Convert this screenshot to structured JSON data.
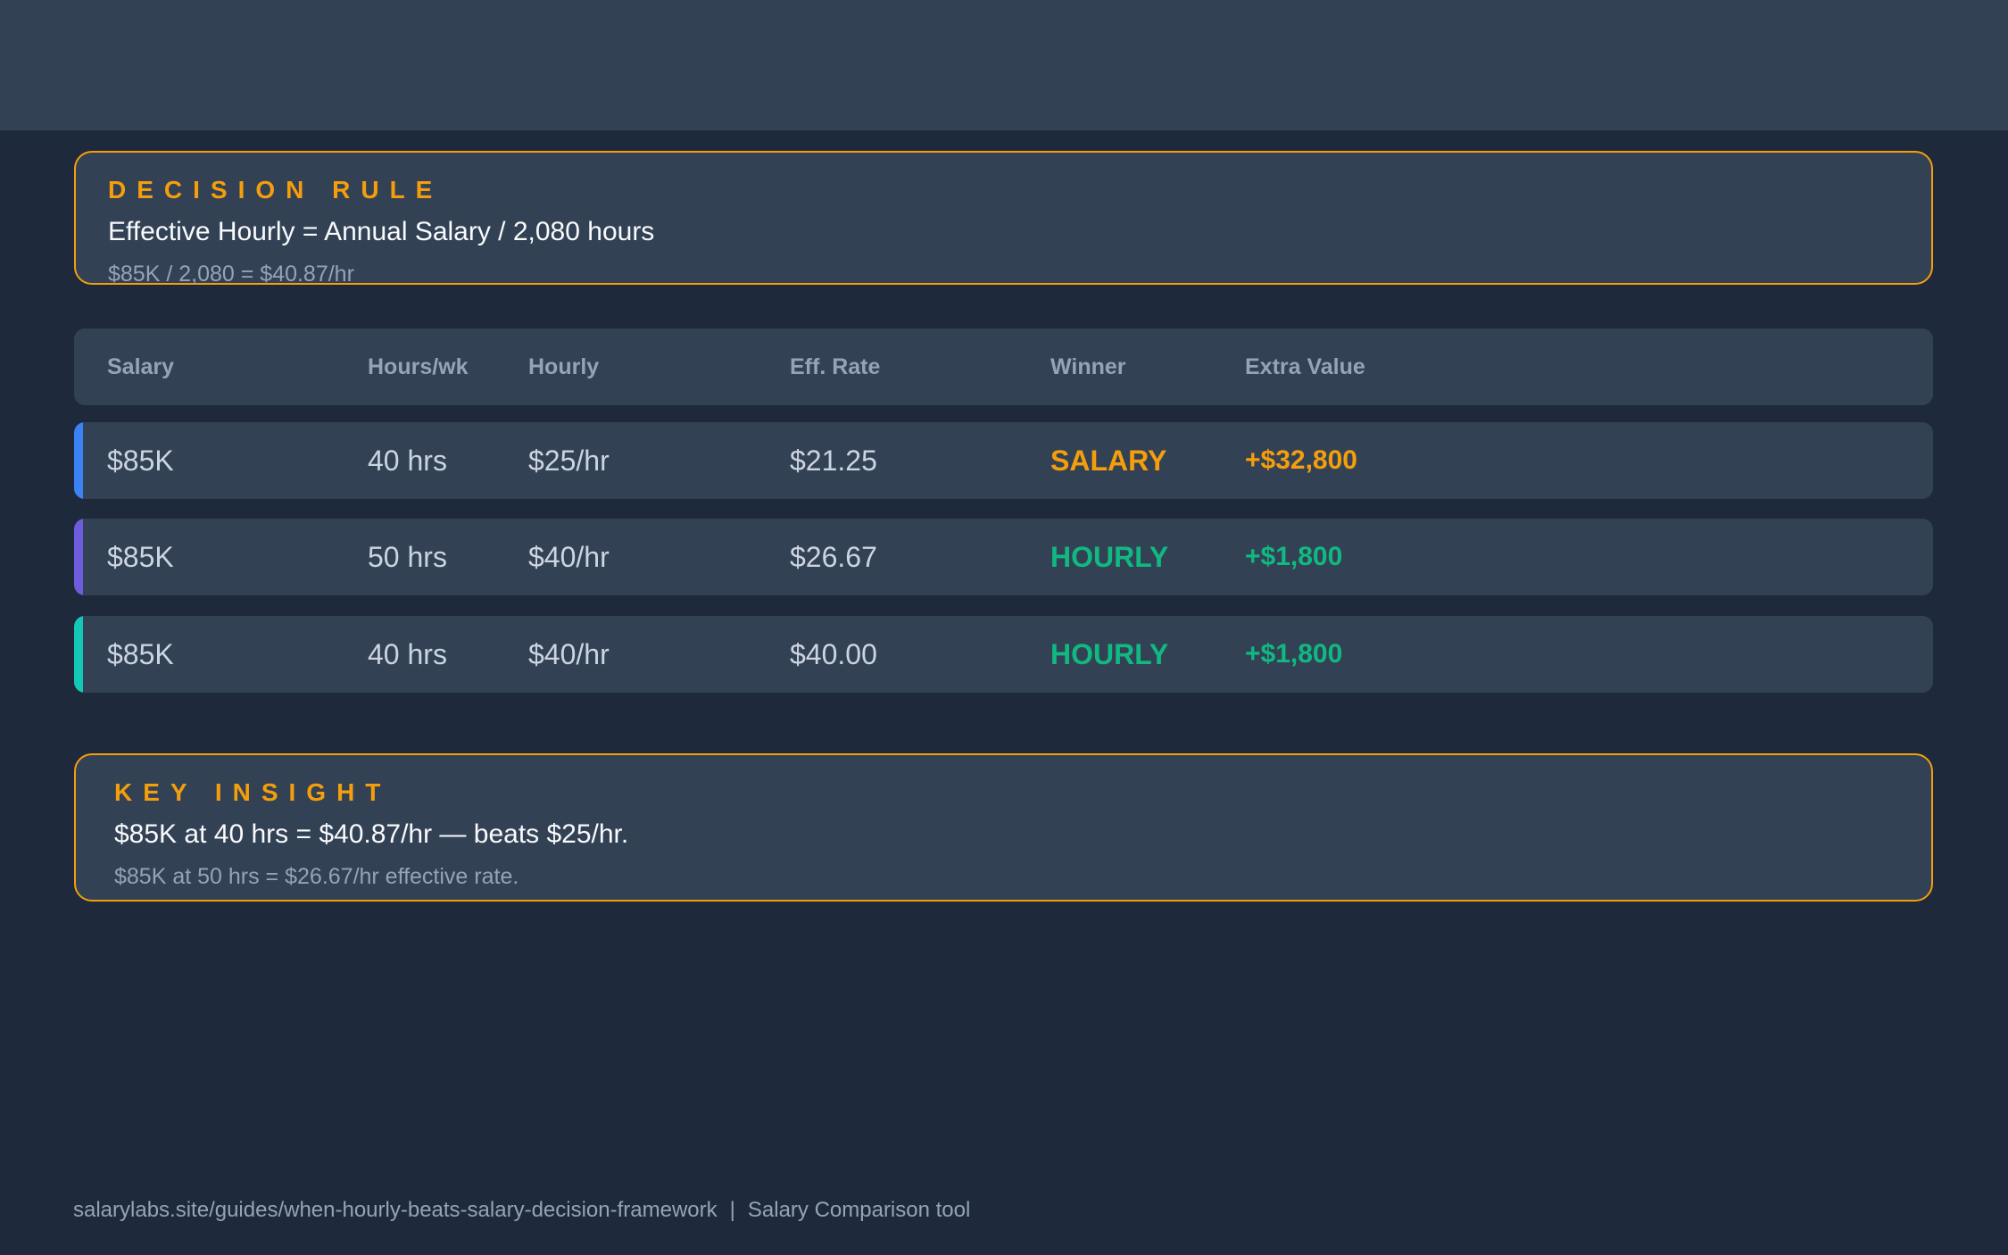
{
  "decision_rule": {
    "label": "DECISION RULE",
    "formula": "Effective Hourly = Annual Salary / 2,080 hours",
    "example": "$85K / 2,080 = $40.87/hr"
  },
  "table": {
    "headers": [
      "Salary",
      "Hours/wk",
      "Hourly",
      "Eff. Rate",
      "Winner",
      "Extra Value"
    ],
    "rows": [
      {
        "salary": "$85K",
        "hours": "40 hrs",
        "hourly": "$25/hr",
        "eff_rate": "$21.25",
        "winner": "SALARY",
        "extra_value": "+$32,800",
        "accent_color": "#3b82f6",
        "winner_color": "#f59e0b"
      },
      {
        "salary": "$85K",
        "hours": "50 hrs",
        "hourly": "$40/hr",
        "eff_rate": "$26.67",
        "winner": "HOURLY",
        "extra_value": "+$1,800",
        "accent_color": "#6d5dde",
        "winner_color": "#10b981"
      },
      {
        "salary": "$85K",
        "hours": "40 hrs",
        "hourly": "$40/hr",
        "eff_rate": "$40.00",
        "winner": "HOURLY",
        "extra_value": "+$1,800",
        "accent_color": "#14c8b8",
        "winner_color": "#10b981"
      }
    ]
  },
  "key_insight": {
    "label": "KEY INSIGHT",
    "main": "$85K at 40 hrs = $40.87/hr — beats $25/hr.",
    "sub": "$85K at 50 hrs = $26.67/hr effective rate."
  },
  "footer": {
    "url": "salarylabs.site/guides/when-hourly-beats-salary-decision-framework",
    "separator": "|",
    "tool": "Salary Comparison tool"
  },
  "colors": {
    "background": "#1e293b",
    "surface": "#334155",
    "accent_amber": "#f59e0b",
    "accent_green": "#10b981",
    "muted_text": "#94a3b8"
  }
}
